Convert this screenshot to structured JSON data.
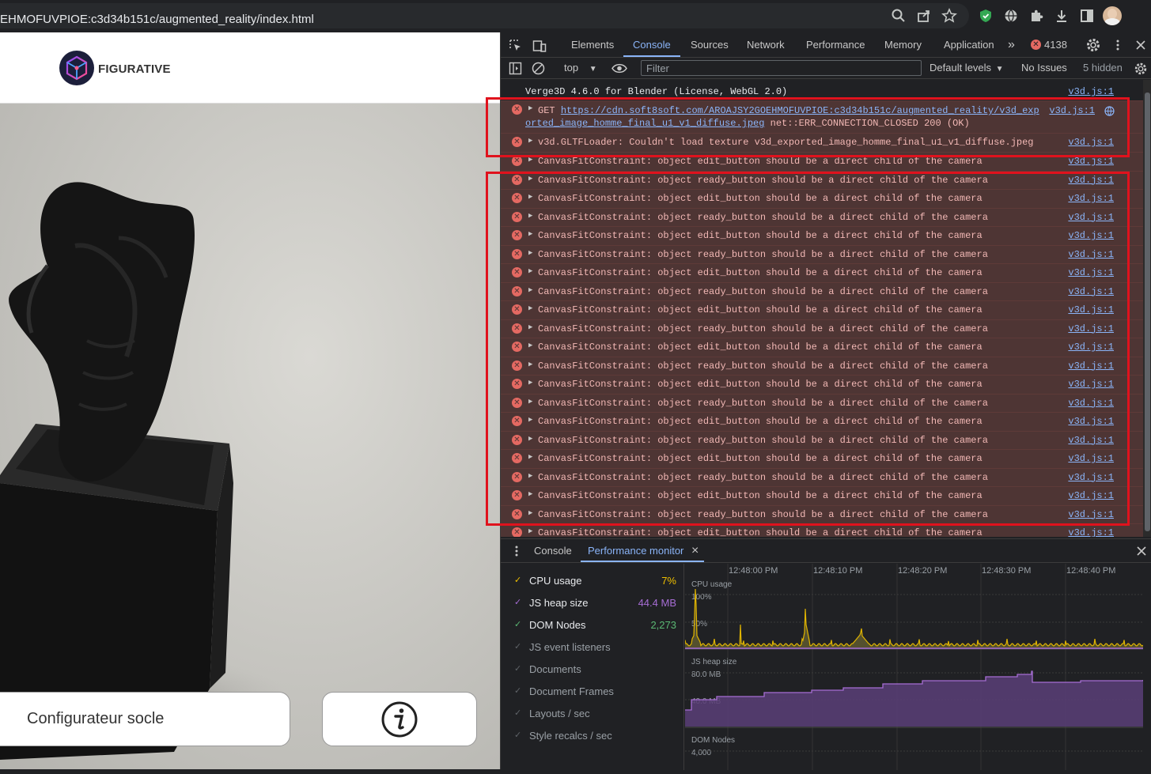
{
  "browser": {
    "url": "EHMOFUVPIOE:c3d34b151c/augmented_reality/index.html",
    "icons": [
      "zoom-icon",
      "share-icon",
      "bookmark-star-icon",
      "shield-extension-icon",
      "globe-extension-icon",
      "puzzle-extensions-icon",
      "download-icon",
      "sidepanel-icon",
      "profile-avatar"
    ]
  },
  "page": {
    "brand": "FIGURATIVE",
    "config_button": "Configurateur socle",
    "info_icon": "info-icon"
  },
  "devtools": {
    "tabs": [
      {
        "label": "Elements"
      },
      {
        "label": "Console"
      },
      {
        "label": "Sources"
      },
      {
        "label": "Network"
      },
      {
        "label": "Performance"
      },
      {
        "label": "Memory"
      },
      {
        "label": "Application"
      }
    ],
    "more_tabs": "»",
    "error_count": "4138",
    "toolbar": {
      "context": "top",
      "filter_placeholder": "Filter",
      "levels": "Default levels",
      "issues": "No Issues",
      "hidden": "5 hidden"
    },
    "console": {
      "info_line": "Verge3D 4.6.0 for Blender (License, WebGL 2.0)",
      "info_source": "v3d.js:1",
      "get_error": {
        "prefix": "GET ",
        "url_line1": "https://cdn.soft8soft.com/AROAJSY2GOEHMOFUVPIOE:c3d34b151c/augmented_reality/v3d_exp",
        "url_line2": "orted_image_homme_final_u1_v1_diffuse.jpeg",
        "suffix": " net::ERR_CONNECTION_CLOSED 200 (OK)",
        "source": "v3d.js:1"
      },
      "loader_error": {
        "text": "v3d.GLTFLoader: Couldn't load texture v3d_exported_image_homme_final_u1_v1_diffuse.jpeg",
        "source": "v3d.js:1"
      },
      "repeat_errors": [
        {
          "text": "CanvasFitConstraint: object edit_button should be a direct child of the camera",
          "source": "v3d.js:1"
        },
        {
          "text": "CanvasFitConstraint: object ready_button should be a direct child of the camera",
          "source": "v3d.js:1"
        },
        {
          "text": "CanvasFitConstraint: object edit_button should be a direct child of the camera",
          "source": "v3d.js:1"
        },
        {
          "text": "CanvasFitConstraint: object ready_button should be a direct child of the camera",
          "source": "v3d.js:1"
        },
        {
          "text": "CanvasFitConstraint: object edit_button should be a direct child of the camera",
          "source": "v3d.js:1"
        },
        {
          "text": "CanvasFitConstraint: object ready_button should be a direct child of the camera",
          "source": "v3d.js:1"
        },
        {
          "text": "CanvasFitConstraint: object edit_button should be a direct child of the camera",
          "source": "v3d.js:1"
        },
        {
          "text": "CanvasFitConstraint: object ready_button should be a direct child of the camera",
          "source": "v3d.js:1"
        },
        {
          "text": "CanvasFitConstraint: object edit_button should be a direct child of the camera",
          "source": "v3d.js:1"
        },
        {
          "text": "CanvasFitConstraint: object ready_button should be a direct child of the camera",
          "source": "v3d.js:1"
        },
        {
          "text": "CanvasFitConstraint: object edit_button should be a direct child of the camera",
          "source": "v3d.js:1"
        },
        {
          "text": "CanvasFitConstraint: object ready_button should be a direct child of the camera",
          "source": "v3d.js:1"
        },
        {
          "text": "CanvasFitConstraint: object edit_button should be a direct child of the camera",
          "source": "v3d.js:1"
        },
        {
          "text": "CanvasFitConstraint: object ready_button should be a direct child of the camera",
          "source": "v3d.js:1"
        },
        {
          "text": "CanvasFitConstraint: object edit_button should be a direct child of the camera",
          "source": "v3d.js:1"
        },
        {
          "text": "CanvasFitConstraint: object ready_button should be a direct child of the camera",
          "source": "v3d.js:1"
        },
        {
          "text": "CanvasFitConstraint: object edit_button should be a direct child of the camera",
          "source": "v3d.js:1"
        },
        {
          "text": "CanvasFitConstraint: object ready_button should be a direct child of the camera",
          "source": "v3d.js:1"
        },
        {
          "text": "CanvasFitConstraint: object edit_button should be a direct child of the camera",
          "source": "v3d.js:1"
        },
        {
          "text": "CanvasFitConstraint: object ready_button should be a direct child of the camera",
          "source": "v3d.js:1"
        },
        {
          "text": "CanvasFitConstraint: object edit_button should be a direct child of the camera",
          "source": "v3d.js:1"
        }
      ]
    },
    "drawer": {
      "tabs": [
        {
          "label": "Console"
        },
        {
          "label": "Performance monitor"
        }
      ],
      "close_tab": "×",
      "metrics": [
        {
          "label": "CPU usage",
          "value": "7%",
          "checked": true,
          "color": "#f0c000"
        },
        {
          "label": "JS heap size",
          "value": "44.4 MB",
          "checked": true,
          "color": "#a66dd4"
        },
        {
          "label": "DOM Nodes",
          "value": "2,273",
          "checked": true,
          "color": "#5bb974"
        },
        {
          "label": "JS event listeners",
          "value": "",
          "checked": false,
          "color": "#9aa0a6"
        },
        {
          "label": "Documents",
          "value": "",
          "checked": false,
          "color": "#9aa0a6"
        },
        {
          "label": "Document Frames",
          "value": "",
          "checked": false,
          "color": "#9aa0a6"
        },
        {
          "label": "Layouts / sec",
          "value": "",
          "checked": false,
          "color": "#9aa0a6"
        },
        {
          "label": "Style recalcs / sec",
          "value": "",
          "checked": false,
          "color": "#9aa0a6"
        }
      ],
      "time_labels": [
        "12:48:00 PM",
        "12:48:10 PM",
        "12:48:20 PM",
        "12:48:30 PM",
        "12:48:40 PM"
      ],
      "cpu_graph": {
        "title": "CPU usage",
        "ticks": [
          "100%",
          "50%"
        ]
      },
      "heap_graph": {
        "title": "JS heap size",
        "ticks": [
          "80.0 MB",
          "40.0 MB"
        ]
      },
      "dom_graph": {
        "title": "DOM Nodes",
        "ticks": [
          "4,000"
        ]
      }
    }
  }
}
